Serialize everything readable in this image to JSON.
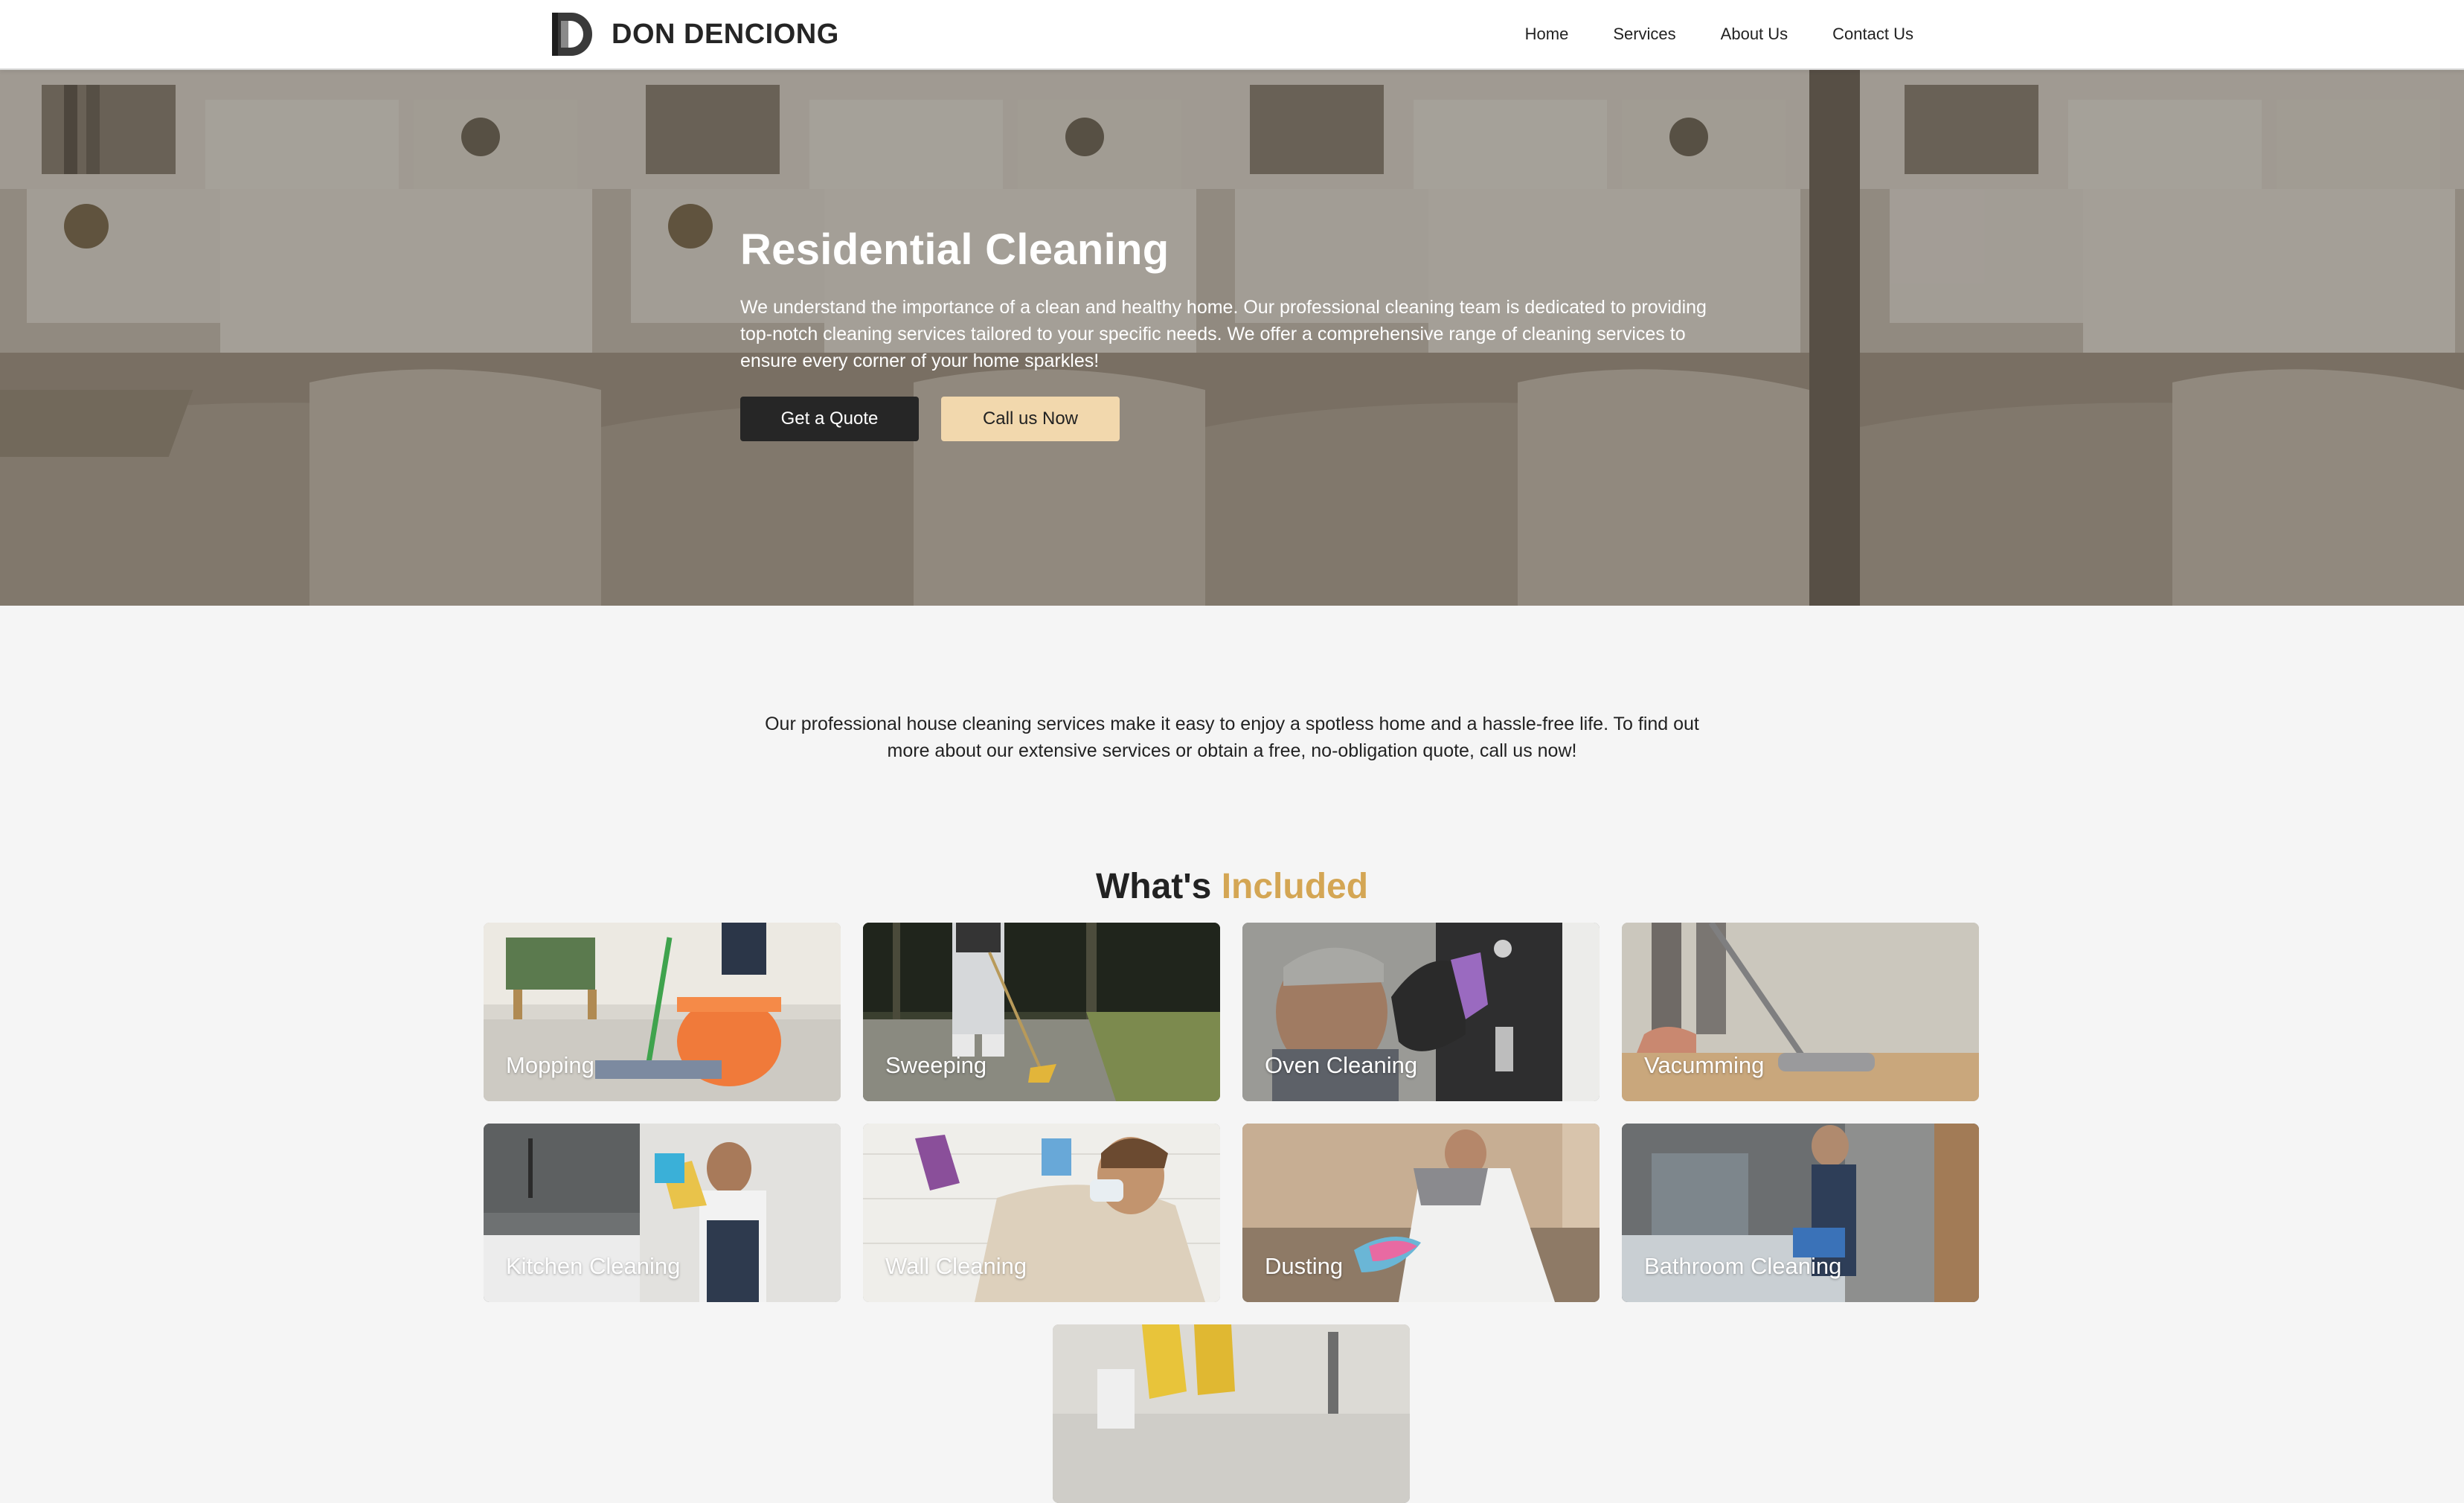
{
  "brand": {
    "name": "DON DENCIONG"
  },
  "nav": {
    "items": [
      "Home",
      "Services",
      "About Us",
      "Contact Us"
    ]
  },
  "hero": {
    "title": "Residential Cleaning",
    "description": "We understand the importance of a clean and healthy home. Our professional cleaning team is dedicated to providing top-notch cleaning services tailored to your specific needs. We offer a comprehensive range of cleaning services to ensure every corner of your home sparkles!",
    "primary_button": "Get a Quote",
    "secondary_button": "Call us Now"
  },
  "intro": {
    "text": "Our professional house cleaning services make it easy to enjoy a spotless home and a hassle-free life. To find out more about our extensive services or obtain a free, no-obligation quote, call us now!"
  },
  "included": {
    "title_prefix": "What's",
    "title_accent": "Included",
    "items": [
      {
        "label": "Mopping",
        "icon": "mopping-photo"
      },
      {
        "label": "Sweeping",
        "icon": "sweeping-photo"
      },
      {
        "label": "Oven Cleaning",
        "icon": "oven-cleaning-photo"
      },
      {
        "label": "Vacumming",
        "icon": "vacuuming-photo"
      },
      {
        "label": "Kitchen Cleaning",
        "icon": "kitchen-cleaning-photo"
      },
      {
        "label": "Wall Cleaning",
        "icon": "wall-cleaning-photo"
      },
      {
        "label": "Dusting",
        "icon": "dusting-photo"
      },
      {
        "label": "Bathroom Cleaning",
        "icon": "bathroom-cleaning-photo"
      },
      {
        "label": "",
        "icon": "cleaning-supplies-photo"
      }
    ]
  },
  "colors": {
    "accent": "#d4a654",
    "primary_button": "#262626",
    "secondary_button": "#f2d8ad",
    "background": "#f5f5f5"
  }
}
